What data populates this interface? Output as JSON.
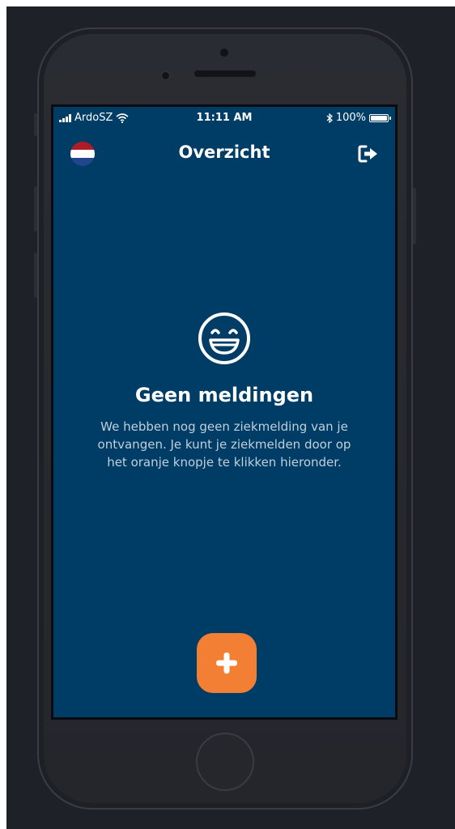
{
  "status_bar": {
    "carrier": "ArdoSZ",
    "time": "11:11 AM",
    "battery_percent": "100%",
    "icons": [
      "signal-icon",
      "wifi-icon",
      "bluetooth-icon",
      "battery-icon"
    ]
  },
  "nav": {
    "title": "Overzicht",
    "language_flag": "netherlands-flag-icon",
    "logout_icon": "logout-icon"
  },
  "empty_state": {
    "icon": "smiley-icon",
    "title": "Geen meldingen",
    "text": "We hebben nog geen ziekmelding van je ontvangen. Je kunt je ziekmelden door op het oranje knopje te klikken hieronder."
  },
  "add_button": {
    "icon": "plus-icon",
    "color": "#f27f34"
  },
  "colors": {
    "screen_background": "#003d66",
    "accent": "#f27f34",
    "backdrop": "#1f2129",
    "flag_red": "#ae1c28",
    "flag_white": "#ffffff",
    "flag_blue": "#21468b"
  }
}
